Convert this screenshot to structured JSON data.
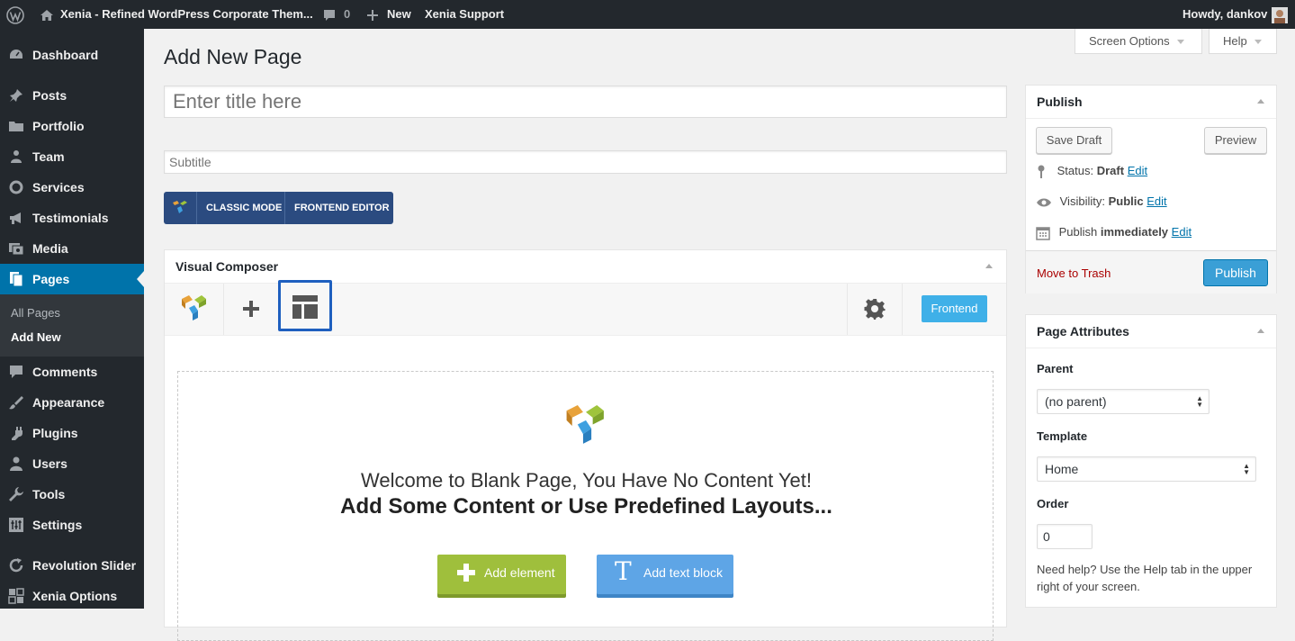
{
  "admin_bar": {
    "site_title": "Xenia - Refined WordPress Corporate Them...",
    "comments_count": "0",
    "new_label": "New",
    "support_label": "Xenia Support",
    "howdy": "Howdy, dankov"
  },
  "sidebar": {
    "items": [
      {
        "label": "Dashboard",
        "icon": "dashboard-icon"
      },
      {
        "label": "Posts",
        "icon": "pin-icon"
      },
      {
        "label": "Portfolio",
        "icon": "folder-icon"
      },
      {
        "label": "Team",
        "icon": "people-icon"
      },
      {
        "label": "Services",
        "icon": "circle-icon"
      },
      {
        "label": "Testimonials",
        "icon": "megaphone-icon"
      },
      {
        "label": "Media",
        "icon": "media-icon"
      },
      {
        "label": "Pages",
        "icon": "pages-icon"
      },
      {
        "label": "Comments",
        "icon": "comment-icon"
      },
      {
        "label": "Appearance",
        "icon": "brush-icon"
      },
      {
        "label": "Plugins",
        "icon": "plug-icon"
      },
      {
        "label": "Users",
        "icon": "user-icon"
      },
      {
        "label": "Tools",
        "icon": "wrench-icon"
      },
      {
        "label": "Settings",
        "icon": "settings-icon"
      },
      {
        "label": "Revolution Slider",
        "icon": "refresh-icon"
      },
      {
        "label": "Xenia Options",
        "icon": "grid-icon"
      }
    ],
    "submenu": [
      "All Pages",
      "Add New"
    ]
  },
  "screen_options_label": "Screen Options",
  "help_label": "Help",
  "page_title": "Add New Page",
  "title_placeholder": "Enter title here",
  "subtitle_placeholder": "Subtitle",
  "vc_switch": {
    "classic": "CLASSIC MODE",
    "frontend": "FRONTEND EDITOR"
  },
  "visual_composer": {
    "title": "Visual Composer",
    "frontend_button": "Frontend",
    "welcome_line1": "Welcome to Blank Page, You Have No Content Yet!",
    "welcome_line2": "Add Some Content or Use Predefined Layouts...",
    "add_element": "Add element",
    "add_text_block": "Add text block"
  },
  "publish": {
    "title": "Publish",
    "save_draft": "Save Draft",
    "preview": "Preview",
    "status_label": "Status:",
    "status_value": "Draft",
    "visibility_label": "Visibility:",
    "visibility_value": "Public",
    "publish_label": "Publish",
    "publish_value": "immediately",
    "edit": "Edit",
    "move_to_trash": "Move to Trash",
    "publish_button": "Publish"
  },
  "page_attributes": {
    "title": "Page Attributes",
    "parent_label": "Parent",
    "parent_value": "(no parent)",
    "template_label": "Template",
    "template_value": "Home",
    "order_label": "Order",
    "order_value": "0",
    "help_text_1": "Need help? Use the Help tab in the upper",
    "help_text_2": "right of your screen."
  },
  "colors": {
    "admin_dark": "#23282d",
    "wp_blue": "#0073aa",
    "vc_blue": "#2b4b80",
    "vc_green": "#9fbf3c",
    "vc_light_blue": "#5ea5e6",
    "publish_blue": "#0085ba",
    "trash_red": "#a00"
  }
}
